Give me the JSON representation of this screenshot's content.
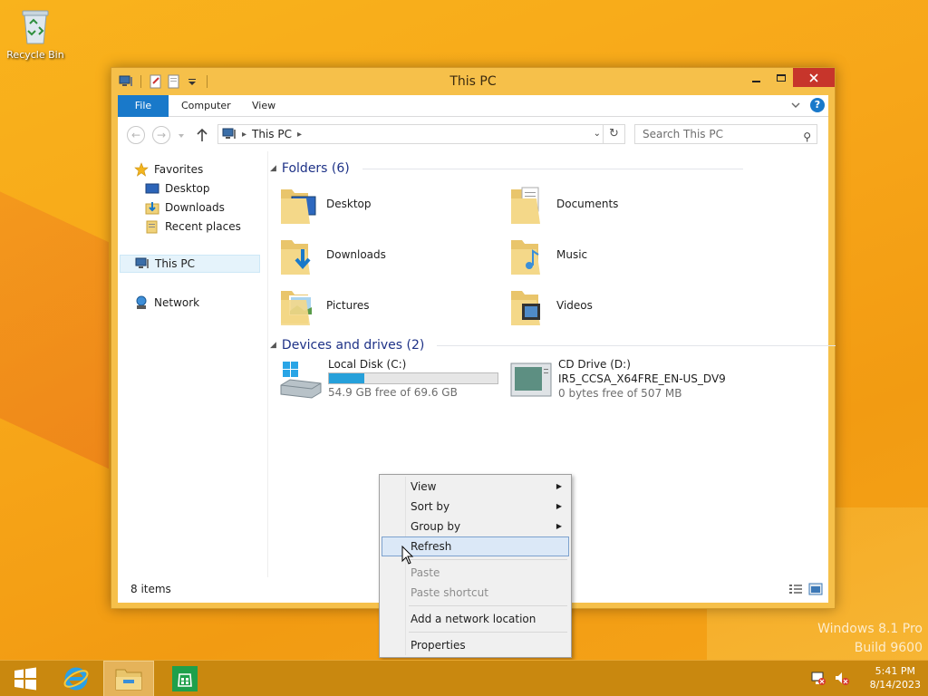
{
  "desktop": {
    "icons": [
      {
        "label": "Recycle Bin",
        "icon": "recycle-bin-icon"
      }
    ],
    "watermark": {
      "line1": "Windows 8.1 Pro",
      "line2": "Build 9600"
    }
  },
  "window": {
    "title": "This PC",
    "ribbon_tabs": {
      "file": "File",
      "computer": "Computer",
      "view": "View"
    },
    "address": {
      "segment": "This PC"
    },
    "search": {
      "placeholder": "Search This PC"
    },
    "nav": {
      "favorites": "Favorites",
      "desktop": "Desktop",
      "downloads": "Downloads",
      "recent": "Recent places",
      "thispc": "This PC",
      "network": "Network"
    },
    "groups": {
      "folders_header": "Folders (6)",
      "devices_header": "Devices and drives (2)"
    },
    "folders": [
      {
        "name": "Desktop",
        "icon": "desktop-folder-icon"
      },
      {
        "name": "Documents",
        "icon": "documents-folder-icon"
      },
      {
        "name": "Downloads",
        "icon": "downloads-folder-icon"
      },
      {
        "name": "Music",
        "icon": "music-folder-icon"
      },
      {
        "name": "Pictures",
        "icon": "pictures-folder-icon"
      },
      {
        "name": "Videos",
        "icon": "videos-folder-icon"
      }
    ],
    "drives": [
      {
        "name": "Local Disk (C:)",
        "free": "54.9 GB free of 69.6 GB",
        "used_fraction": 0.21
      },
      {
        "name": "CD Drive (D:)",
        "label": "IR5_CCSA_X64FRE_EN-US_DV9",
        "free": "0 bytes free of 507 MB"
      }
    ],
    "status": {
      "items": "8 items"
    }
  },
  "context_menu": {
    "view": "View",
    "sort_by": "Sort by",
    "group_by": "Group by",
    "refresh": "Refresh",
    "paste": "Paste",
    "paste_shortcut": "Paste shortcut",
    "add_network": "Add a network location",
    "properties": "Properties"
  },
  "taskbar": {
    "clock": {
      "time": "5:41 PM",
      "date": "8/14/2023"
    }
  },
  "colors": {
    "accent": "#1979ca",
    "close": "#c7352b",
    "bar_fill": "#26a0da",
    "header_text": "#1e3287"
  }
}
